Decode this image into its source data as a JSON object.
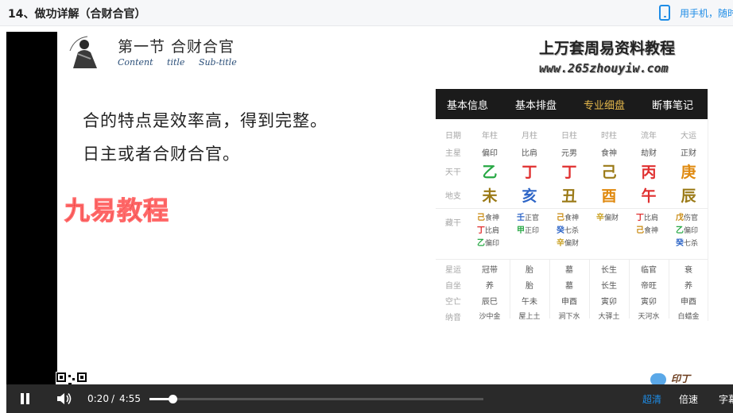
{
  "page": {
    "title": "14、做功详解（合财合官）",
    "mobile_link": "用手机，随时"
  },
  "slide": {
    "section_title": "第一节  合财合官",
    "section_subtitle": "Content title  Sub-title",
    "brand_name": "上万套周易资料教程",
    "brand_url": "www.265zhouyiw.com",
    "lines": [
      "合的特点是效率高，得到完整。",
      "日主或者合财合官。"
    ],
    "watermark": "九易教程",
    "corner_logo": "印丁"
  },
  "bazi": {
    "tabs": [
      {
        "label": "基本信息",
        "active": false
      },
      {
        "label": "基本排盘",
        "active": false
      },
      {
        "label": "专业细盘",
        "active": true
      },
      {
        "label": "断事笔记",
        "active": false
      }
    ],
    "row_labels": {
      "date": "日期",
      "main_star": "主星",
      "stem": "天干",
      "branch": "地支",
      "hidden": "藏干",
      "star_fortune": "星运",
      "self_seat": "自坐",
      "void": "空亡",
      "nayin": "纳音"
    },
    "columns": [
      {
        "header": "年柱",
        "main_star": "偏印",
        "stem": "乙",
        "stem_color": "#27a844",
        "branch": "未",
        "branch_color": "#9b7a17",
        "hidden": [
          {
            "stem": "己",
            "god": "食神",
            "color": "#c98a10"
          },
          {
            "stem": "丁",
            "god": "比肩",
            "color": "#e03030"
          },
          {
            "stem": "乙",
            "god": "偏印",
            "color": "#27a844"
          }
        ],
        "star_fortune": "冠带",
        "self_seat": "养",
        "void": "辰巳",
        "nayin": "沙中金"
      },
      {
        "header": "月柱",
        "main_star": "比肩",
        "stem": "丁",
        "stem_color": "#e03030",
        "branch": "亥",
        "branch_color": "#2f66c7",
        "hidden": [
          {
            "stem": "壬",
            "god": "正官",
            "color": "#2f66c7"
          },
          {
            "stem": "甲",
            "god": "正印",
            "color": "#27a844"
          }
        ],
        "star_fortune": "胎",
        "self_seat": "胎",
        "void": "午未",
        "nayin": "屋上土"
      },
      {
        "header": "日柱",
        "main_star": "元男",
        "stem": "丁",
        "stem_color": "#e03030",
        "branch": "丑",
        "branch_color": "#9b7a17",
        "hidden": [
          {
            "stem": "己",
            "god": "食神",
            "color": "#c98a10"
          },
          {
            "stem": "癸",
            "god": "七杀",
            "color": "#2f66c7"
          },
          {
            "stem": "辛",
            "god": "偏财",
            "color": "#c9a020"
          }
        ],
        "star_fortune": "墓",
        "self_seat": "墓",
        "void": "申酉",
        "nayin": "涧下水"
      },
      {
        "header": "时柱",
        "main_star": "食神",
        "stem": "己",
        "stem_color": "#9b7a17",
        "branch": "酉",
        "branch_color": "#e08a10",
        "hidden": [
          {
            "stem": "辛",
            "god": "偏财",
            "color": "#c9a020"
          }
        ],
        "star_fortune": "长生",
        "self_seat": "长生",
        "void": "寅卯",
        "nayin": "大驿土"
      },
      {
        "header": "流年",
        "main_star": "劫财",
        "stem": "丙",
        "stem_color": "#e03030",
        "branch": "午",
        "branch_color": "#e03030",
        "hidden": [
          {
            "stem": "丁",
            "god": "比肩",
            "color": "#e03030"
          },
          {
            "stem": "己",
            "god": "食神",
            "color": "#c98a10"
          }
        ],
        "star_fortune": "临官",
        "self_seat": "帝旺",
        "void": "寅卯",
        "nayin": "天河水"
      },
      {
        "header": "大运",
        "main_star": "正财",
        "stem": "庚",
        "stem_color": "#e08a10",
        "branch": "辰",
        "branch_color": "#9b7a17",
        "hidden": [
          {
            "stem": "戊",
            "god": "伤官",
            "color": "#c98a10"
          },
          {
            "stem": "乙",
            "god": "偏印",
            "color": "#27a844"
          },
          {
            "stem": "癸",
            "god": "七杀",
            "color": "#2f66c7"
          }
        ],
        "star_fortune": "衰",
        "self_seat": "养",
        "void": "申酉",
        "nayin": "白蜡金"
      }
    ]
  },
  "player": {
    "current_time": "0:20",
    "time_separator": "/",
    "duration": "4:55",
    "progress_fraction": 0.068,
    "quality_label": "超清",
    "speed_label": "倍速",
    "subtitle_label": "字幕"
  },
  "colors": {
    "accent": "#1e8ce6",
    "active_tab": "#e6b94c",
    "watermark": "#e03030"
  }
}
